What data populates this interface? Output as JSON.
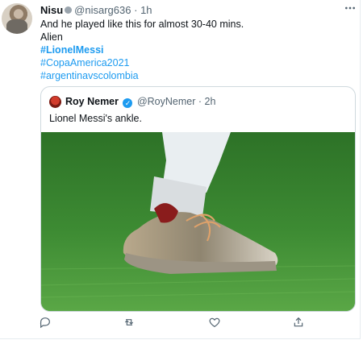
{
  "tweet": {
    "author_name": "Nisu",
    "handle": "@nisarg636",
    "separator": "·",
    "time": "1h",
    "more_icon": "more-icon",
    "lines": [
      "And he played like this for almost 30-40 mins.",
      "Alien"
    ],
    "hashtags": [
      "#LionelMessi",
      "#CopaAmerica2021",
      "#argentinavscolombia"
    ]
  },
  "quote": {
    "author_name": "Roy Nemer",
    "handle": "@RoyNemer",
    "separator": "·",
    "time": "2h",
    "verified_icon": "verified-icon",
    "text": "Lionel Messi's ankle."
  },
  "actions": {
    "icons": [
      "reply-icon",
      "retweet-icon",
      "like-icon",
      "share-icon"
    ]
  },
  "colors": {
    "link": "#1d9bf0",
    "muted": "#536471",
    "border": "#cfd9de"
  }
}
